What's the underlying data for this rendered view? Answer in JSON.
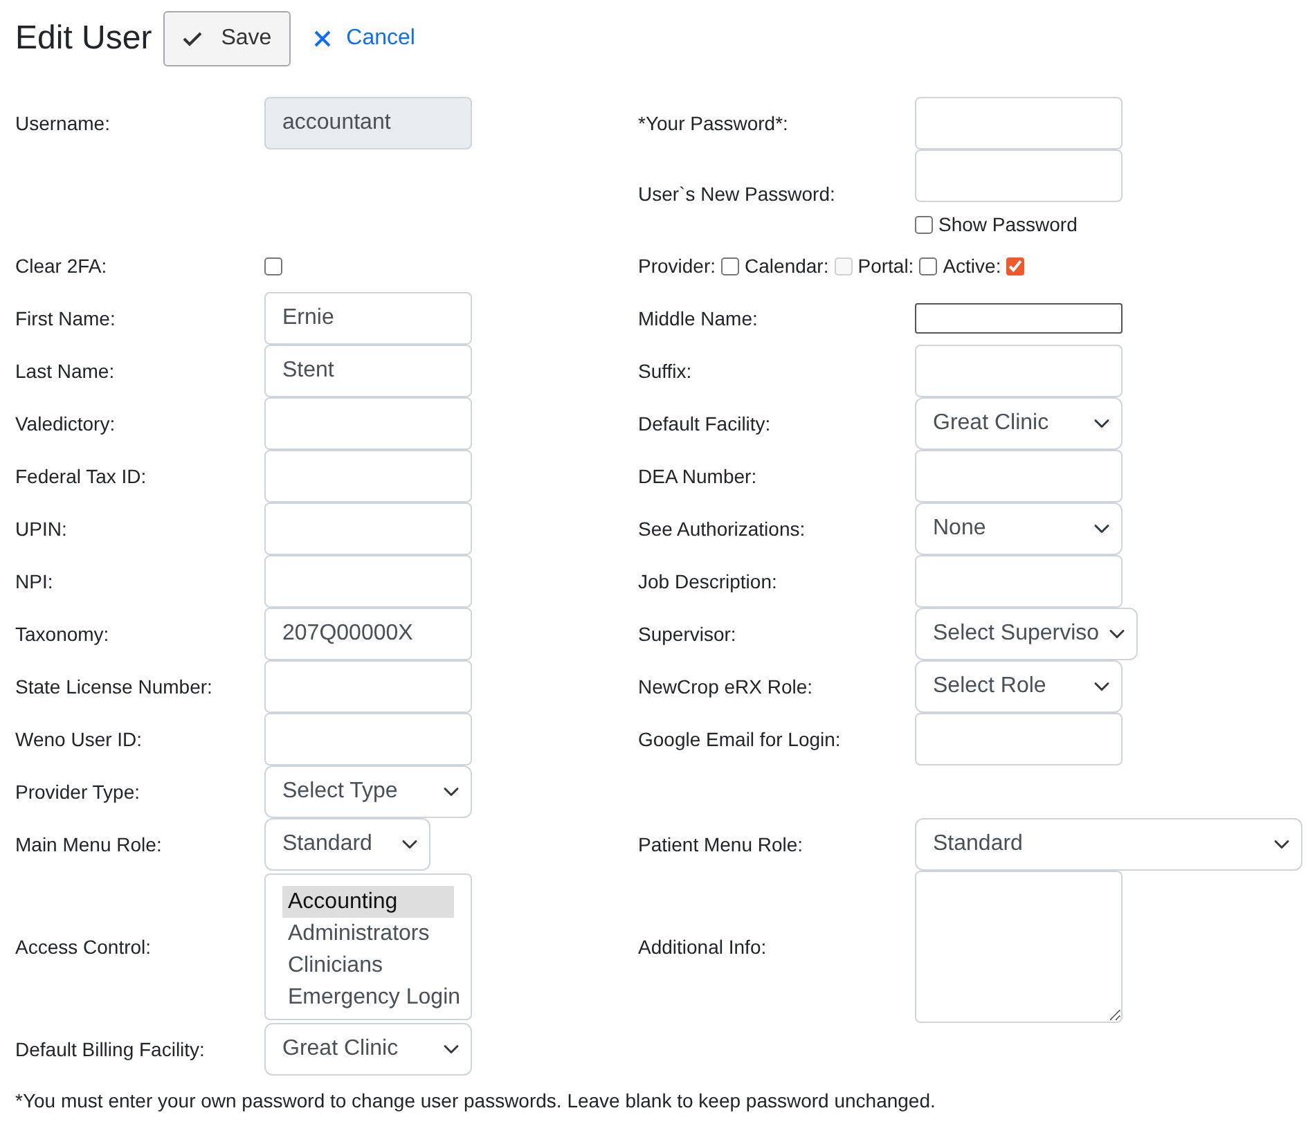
{
  "title": "Edit User",
  "actions": {
    "save": "Save",
    "cancel": "Cancel"
  },
  "rows": [
    {
      "left": {
        "label": "Username:",
        "field": {
          "kind": "text",
          "value": "accountant",
          "disabled": true
        }
      },
      "right": {
        "label": "*Your Password*:",
        "field": {
          "kind": "text"
        }
      }
    },
    {
      "right": {
        "label": "User`s New Password:",
        "field": {
          "kind": "text",
          "show_password": {
            "label": "Show Password",
            "checked": false
          }
        }
      }
    },
    {
      "left": {
        "label": "Clear 2FA:",
        "field": {
          "kind": "checkbox",
          "checked": false
        }
      },
      "right": {
        "flags": [
          {
            "label": "Provider:",
            "checked": false,
            "disabled": false
          },
          {
            "label": "Calendar:",
            "checked": false,
            "disabled": true
          },
          {
            "label": "Portal:",
            "checked": false,
            "disabled": false
          },
          {
            "label": "Active:",
            "checked": true,
            "disabled": false
          }
        ]
      }
    },
    {
      "left": {
        "label": "First Name:",
        "field": {
          "kind": "text",
          "value": "Ernie"
        }
      },
      "right": {
        "label": "Middle Name:",
        "field": {
          "kind": "plain"
        }
      }
    },
    {
      "left": {
        "label": "Last Name:",
        "field": {
          "kind": "text",
          "value": "Stent"
        }
      },
      "right": {
        "label": "Suffix:",
        "field": {
          "kind": "text"
        }
      }
    },
    {
      "left": {
        "label": "Valedictory:",
        "field": {
          "kind": "text"
        }
      },
      "right": {
        "label": "Default Facility:",
        "field": {
          "kind": "select",
          "value": "Great Clinic"
        }
      }
    },
    {
      "left": {
        "label": "Federal Tax ID:",
        "field": {
          "kind": "text"
        }
      },
      "right": {
        "label": "DEA Number:",
        "field": {
          "kind": "text"
        }
      }
    },
    {
      "left": {
        "label": "UPIN:",
        "field": {
          "kind": "text"
        }
      },
      "right": {
        "label": "See Authorizations:",
        "field": {
          "kind": "select",
          "value": "None"
        }
      }
    },
    {
      "left": {
        "label": "NPI:",
        "field": {
          "kind": "text"
        }
      },
      "right": {
        "label": "Job Description:",
        "field": {
          "kind": "text"
        }
      }
    },
    {
      "left": {
        "label": "Taxonomy:",
        "field": {
          "kind": "text",
          "value": "207Q00000X"
        }
      },
      "right": {
        "label": "Supervisor:",
        "field": {
          "kind": "select",
          "value": "Select Superviso"
        }
      }
    },
    {
      "left": {
        "label": "State License Number:",
        "field": {
          "kind": "text"
        }
      },
      "right": {
        "label": "NewCrop eRX Role:",
        "field": {
          "kind": "select",
          "value": "Select Role"
        }
      }
    },
    {
      "left": {
        "label": "Weno User ID:",
        "field": {
          "kind": "text"
        }
      },
      "right": {
        "label": "Google Email for Login:",
        "field": {
          "kind": "text"
        }
      }
    },
    {
      "left": {
        "label": "Provider Type:",
        "field": {
          "kind": "select",
          "value": "Select Type"
        }
      }
    },
    {
      "left": {
        "label": "Main Menu Role:",
        "field": {
          "kind": "select-narrow",
          "value": "Standard"
        }
      },
      "right": {
        "label": "Patient Menu Role:",
        "field": {
          "kind": "select-wide",
          "value": "Standard"
        }
      }
    },
    {
      "left": {
        "label": "Access Control:",
        "field": {
          "kind": "listbox",
          "options": [
            {
              "label": "Accounting",
              "selected": true
            },
            {
              "label": "Administrators",
              "selected": false
            },
            {
              "label": "Clinicians",
              "selected": false
            },
            {
              "label": "Emergency Login",
              "selected": false
            }
          ]
        }
      },
      "right": {
        "label": "Additional Info:",
        "field": {
          "kind": "textarea"
        }
      }
    },
    {
      "left": {
        "label": "Default Billing Facility:",
        "field": {
          "kind": "select",
          "value": "Great Clinic"
        }
      }
    }
  ],
  "footnote": "*You must enter your own password to change user passwords. Leave blank to keep password unchanged."
}
